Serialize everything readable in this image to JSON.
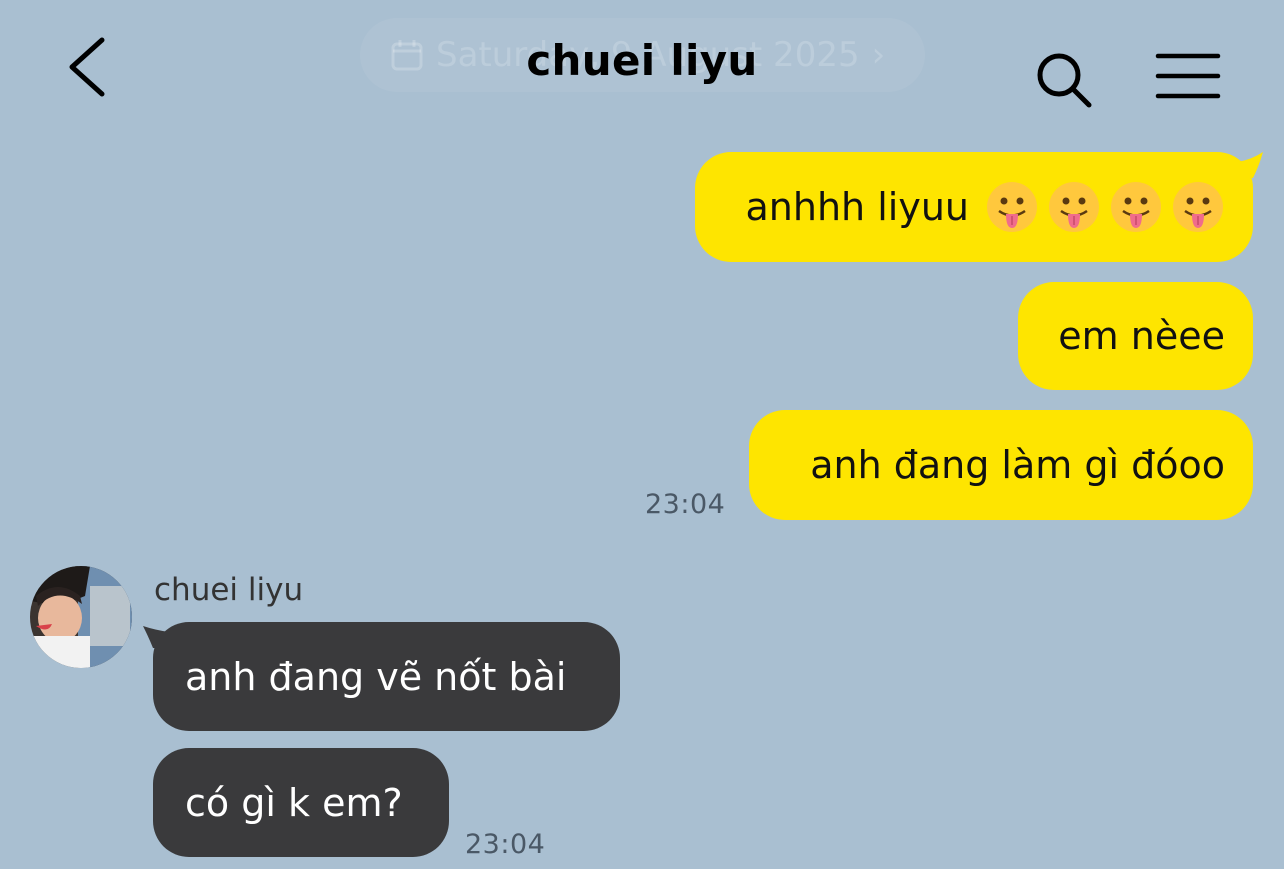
{
  "header": {
    "title": "chuei liyu",
    "date_pill": "Saturday, 9 August 2025"
  },
  "icons": {
    "back": "chevron-left-icon",
    "search": "search-icon",
    "menu": "hamburger-menu-icon",
    "calendar": "calendar-icon",
    "emoji": "face-with-tongue-emoji"
  },
  "colors": {
    "background": "#a9bfd1",
    "my_bubble": "#fee500",
    "their_bubble": "#3a3a3c"
  },
  "messages_sent": [
    {
      "text": "anhhh liyuu",
      "emoji": "😛😛😛😛"
    },
    {
      "text": "em nèee"
    },
    {
      "text": "anh đang làm gì đóoo"
    }
  ],
  "sent_time": "23:04",
  "sender": {
    "name": "chuei liyu"
  },
  "messages_received": [
    {
      "text": "anh đang vẽ nốt bài"
    },
    {
      "text": "có gì k em?"
    }
  ],
  "received_time": "23:04"
}
